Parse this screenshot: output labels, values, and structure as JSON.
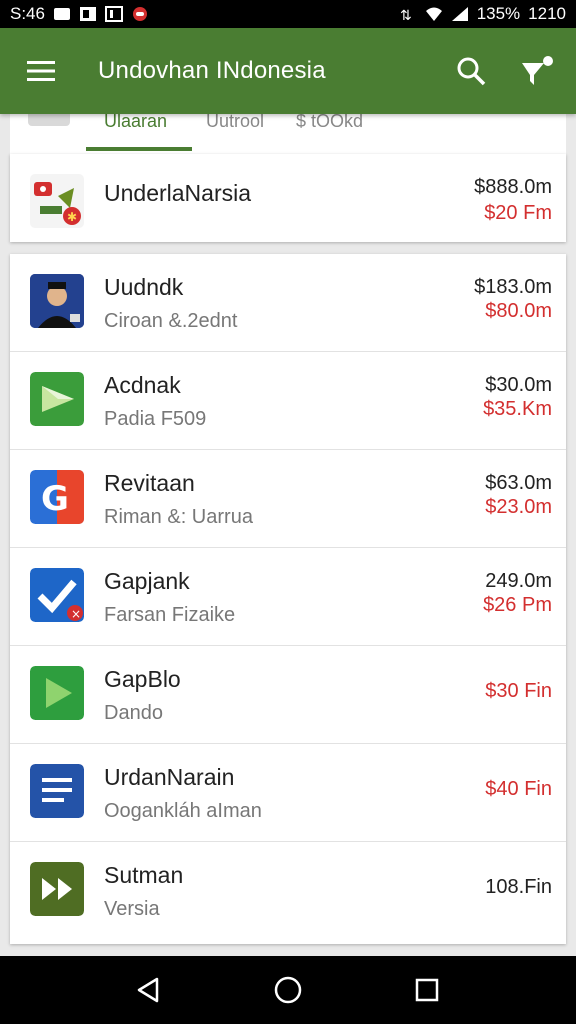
{
  "status_bar": {
    "time": "S:46",
    "battery": "135%",
    "clock": "1210"
  },
  "app_bar": {
    "title": "Undovhan INdonesia",
    "menu_icon": "hamburger-menu-icon",
    "search_icon": "search-icon",
    "filter_icon": "filter-icon"
  },
  "tabs": [
    {
      "label": "Ulaaran",
      "active": true
    },
    {
      "label": "Uutrool",
      "active": false
    },
    {
      "label": "$ tOOkd",
      "active": false
    }
  ],
  "featured": {
    "name": "UnderlaNarsia",
    "price": "$888.0m",
    "price2": "$20 Fm"
  },
  "rows": [
    {
      "name": "Uudndk",
      "sub": "Ciroan &.2ednt",
      "price": "$183.0m",
      "price2": "$80.0m",
      "icon": "portrait-icon",
      "color": "#1f3a8a"
    },
    {
      "name": "Acdnak",
      "sub": "Padia F509",
      "price": "$30.0m",
      "price2": "$35.Km",
      "icon": "play-store-icon",
      "color": "#3b9d3b"
    },
    {
      "name": "Revitaan",
      "sub": "Riman &: Uarrua",
      "price": "$63.0m",
      "price2": "$23.0m",
      "icon": "google-g-icon",
      "color": "#e8452c"
    },
    {
      "name": "Gapjank",
      "sub": "Farsan Fizaike",
      "price": "249.0m",
      "price2": "$26 Pm",
      "icon": "checkmark-icon",
      "color": "#1e66c8"
    },
    {
      "name": "GapBlo",
      "sub": "Dando",
      "price": "",
      "price2": "$30 Fin",
      "icon": "play-arrow-icon",
      "color": "#2e9e3e"
    },
    {
      "name": "UrdanNarain",
      "sub": "Oogankláh aIman",
      "price": "",
      "price2": "$40 Fin",
      "icon": "document-list-icon",
      "color": "#2453a8"
    },
    {
      "name": "Sutman",
      "sub": "Versia",
      "price": "108.Fin",
      "price2": "",
      "icon": "fast-forward-icon",
      "color": "#4f6d23"
    }
  ],
  "nav": {
    "back_icon": "back-triangle-icon",
    "home_icon": "home-circle-icon",
    "recents_icon": "recents-square-icon"
  }
}
